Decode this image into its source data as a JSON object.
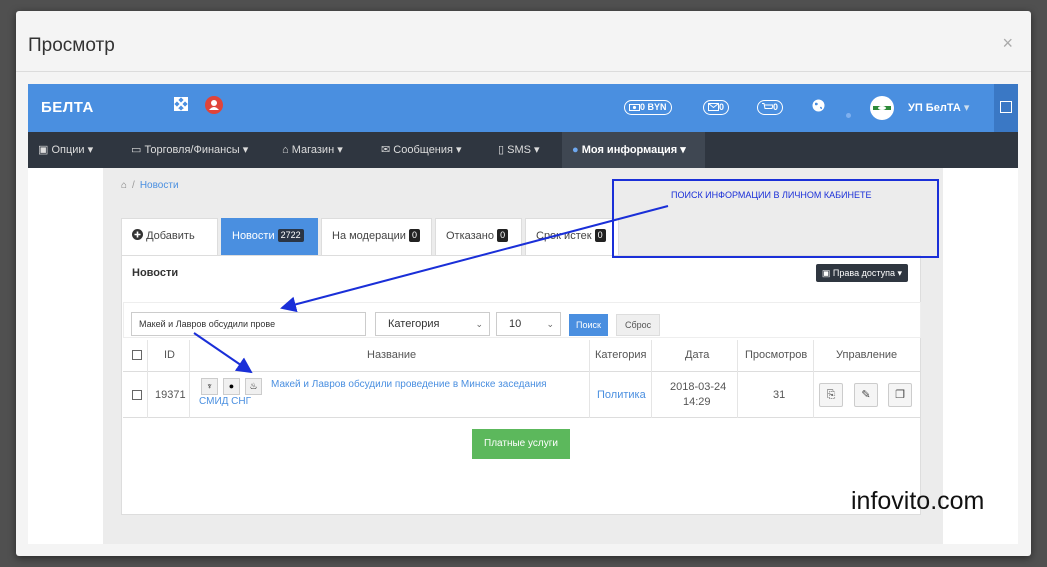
{
  "modal": {
    "title": "Просмотр",
    "close": "×"
  },
  "topbar": {
    "brand": "БЕЛТА",
    "balance": "0 BYN",
    "messages_count": "0",
    "cart_count": "0",
    "user": "УП БелТА",
    "user_caret": "▾"
  },
  "nav": [
    {
      "label": "Опции",
      "icon": "options-icon"
    },
    {
      "label": "Торговля/Финансы",
      "icon": "money-icon"
    },
    {
      "label": "Магазин",
      "icon": "shop-icon"
    },
    {
      "label": "Сообщения",
      "icon": "envelope-icon"
    },
    {
      "label": "SMS",
      "icon": "phone-icon"
    },
    {
      "label": "Моя информация",
      "icon": "user-icon"
    }
  ],
  "breadcrumb": {
    "current": "Новости"
  },
  "tabs": {
    "add": "Добавить",
    "news": "Новости",
    "news_count": "2722",
    "moderation": "На модерации",
    "moderation_count": "0",
    "rejected": "Отказано",
    "rejected_count": "0",
    "expired": "Срок истек",
    "expired_count": "0"
  },
  "panel": {
    "title": "Новости",
    "access_button": "Права доступа"
  },
  "filter": {
    "search_value": "Макей и Лавров обсудили прове",
    "category": "Категория",
    "page_size": "10",
    "search_button": "Поиск",
    "reset_button": "Сброс"
  },
  "table": {
    "headers": {
      "id": "ID",
      "title": "Название",
      "category": "Категория",
      "date": "Дата",
      "views": "Просмотров",
      "actions": "Управление"
    },
    "rows": [
      {
        "id": "19371",
        "title_line1": "Макей и Лавров обсудили проведение в Минске заседания",
        "title_line2": "СМИД СНГ",
        "category": "Политика",
        "date": "2018-03-24",
        "time": "14:29",
        "views": "31"
      }
    ]
  },
  "paid_button": "Платные услуги",
  "annotation": {
    "text": "ПОИСК ИНФОРМАЦИИ В ЛИЧНОМ КАБИНЕТЕ"
  },
  "watermark": "infovito.com",
  "colors": {
    "topbar": "#4a8fe0",
    "navbar": "#2f3640",
    "annotation": "#1a2fd8",
    "paid": "#5cb85c"
  }
}
